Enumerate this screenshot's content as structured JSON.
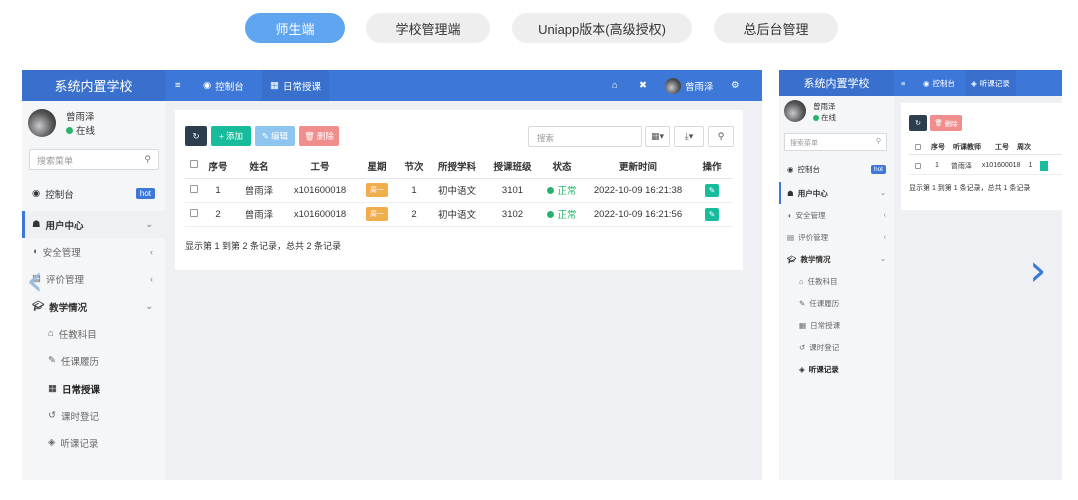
{
  "tabs": [
    {
      "label": "师生端",
      "active": true
    },
    {
      "label": "学校管理端",
      "active": false
    },
    {
      "label": "Uniapp版本(高级授权)",
      "active": false
    },
    {
      "label": "总后台管理",
      "active": false
    }
  ],
  "left": {
    "brand": "系统内置学校",
    "nav": {
      "dashboard": "控制台",
      "daily": "日常授课",
      "username": "曾雨泽"
    },
    "user": {
      "name": "曾雨泽",
      "status": "在线"
    },
    "search_placeholder": "搜索菜单",
    "menu": {
      "dashboard": "控制台",
      "hot": "hot",
      "user_center": "用户中心",
      "security": "安全管理",
      "evaluation": "评价管理",
      "teaching": "教学情况",
      "subjects": "任教科目",
      "history": "任课履历",
      "daily": "日常授课",
      "hours": "课时登记",
      "listen": "听课记录"
    },
    "toolbar": {
      "add": "添加",
      "edit": "编辑",
      "delete": "删除",
      "search_placeholder": "搜索"
    },
    "table": {
      "headers": [
        "序号",
        "姓名",
        "工号",
        "星期",
        "节次",
        "所授学科",
        "授课班级",
        "状态",
        "更新时间",
        "操作"
      ],
      "rows": [
        {
          "idx": "1",
          "name": "曾雨泽",
          "id": "x101600018",
          "week": "周一",
          "period": "1",
          "subject": "初中语文",
          "class": "3101",
          "status": "正常",
          "time": "2022-10-09 16:21:38"
        },
        {
          "idx": "2",
          "name": "曾雨泽",
          "id": "x101600018",
          "week": "周一",
          "period": "2",
          "subject": "初中语文",
          "class": "3102",
          "status": "正常",
          "time": "2022-10-09 16:21:56"
        }
      ],
      "summary": "显示第 1 到第 2 条记录，总共 2 条记录"
    }
  },
  "right": {
    "brand": "系统内置学校",
    "nav": {
      "dashboard": "控制台",
      "listen": "听课记录"
    },
    "user": {
      "name": "曾雨泽",
      "status": "在线"
    },
    "search_placeholder": "搜索菜单",
    "menu": {
      "dashboard": "控制台",
      "hot": "hot",
      "user_center": "用户中心",
      "security": "安全管理",
      "evaluation": "评价管理",
      "teaching": "教学情况",
      "subjects": "任教科目",
      "history": "任课履历",
      "daily": "日常授课",
      "hours": "课时登记",
      "listen": "听课记录"
    },
    "toolbar": {
      "delete": "删除"
    },
    "table": {
      "headers": [
        "序号",
        "听课教师",
        "工号",
        "周次"
      ],
      "row": {
        "idx": "1",
        "teacher": "曾雨泽",
        "id": "x101600018",
        "week": "1"
      },
      "summary": "显示第 1 到第 1 条记录，总共 1 条记录"
    }
  },
  "colors": {
    "primary": "#3d78d8",
    "accent_tab": "#60a5f0",
    "success": "#18bc9c",
    "danger": "#f08e8e",
    "warning": "#f0ad4e"
  },
  "icons": [
    "menu-icon",
    "dashboard-icon",
    "grid-icon",
    "home-icon",
    "fullscreen-icon",
    "settings-icon",
    "refresh-icon",
    "search-icon",
    "chevron-left-icon",
    "chevron-right-icon"
  ]
}
